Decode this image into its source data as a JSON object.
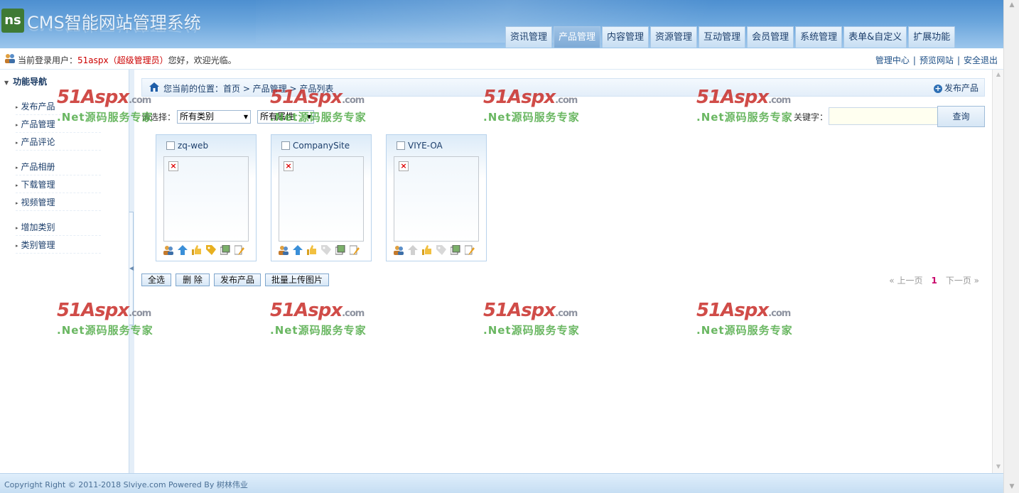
{
  "header": {
    "logo_mark": "ns",
    "system_title": "CMS智能网站管理系统",
    "tabs": [
      {
        "label": "资讯管理"
      },
      {
        "label": "产品管理"
      },
      {
        "label": "内容管理"
      },
      {
        "label": "资源管理"
      },
      {
        "label": "互动管理"
      },
      {
        "label": "会员管理"
      },
      {
        "label": "系统管理"
      },
      {
        "label": "表单&自定义"
      },
      {
        "label": "扩展功能"
      }
    ],
    "active_tab": "产品管理"
  },
  "userbar": {
    "prefix": "当前登录用户：",
    "username": "51aspx（超级管理员）",
    "greeting": "您好，欢迎光临。",
    "links": [
      "管理中心",
      "预览网站",
      "安全退出"
    ]
  },
  "sidebar": {
    "title": "功能导航",
    "groups": [
      [
        "发布产品",
        "产品管理",
        "产品评论"
      ],
      [
        "产品相册",
        "下载管理",
        "视频管理"
      ],
      [
        "增加类别",
        "类别管理"
      ]
    ]
  },
  "main": {
    "breadcrumb": "您当前的位置：首页 > 产品管理 > 产品列表",
    "publish_link": "发布产品",
    "filter_label": "请选择：",
    "category_select": "所有类别",
    "attribute_select": "所有属性",
    "keyword_label": "关键字：",
    "keyword_value": "",
    "search_button": "查询",
    "products": [
      {
        "name": "zq-web"
      },
      {
        "name": "CompanySite"
      },
      {
        "name": "VIYE-OA"
      }
    ],
    "actions": [
      "全选",
      "删 除",
      "发布产品",
      "批量上传图片"
    ],
    "pager": {
      "prev": "« 上一页",
      "current": "1",
      "next": "下一页 »"
    }
  },
  "watermark": {
    "line1": "51Aspx",
    "suffix": ".com",
    "line2": ".Net源码服务专家"
  },
  "footer": {
    "copyright": "Copyright Right © 2011-2018 Slviye.com Powered By 树林伟业"
  },
  "colors": {
    "accent": "#4d8fd0",
    "username": "#cc0000",
    "pager_current": "#c8006a",
    "watermark_red": "#c82d28",
    "watermark_green": "#50aa46"
  }
}
